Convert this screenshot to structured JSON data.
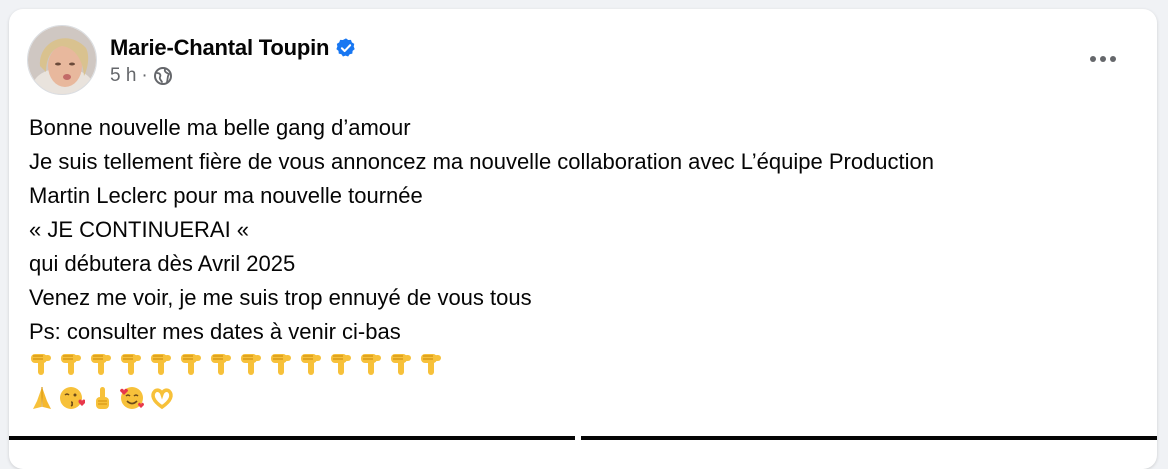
{
  "post": {
    "author_name": "Marie-Chantal Toupin",
    "timestamp": "5 h",
    "separator": "·",
    "audience_icon": "globe-icon",
    "verified_icon": "verified-badge-icon",
    "more_icon": "more-options-icon",
    "lines": [
      "Bonne nouvelle ma belle gang d’amour",
      "Je suis tellement fière de vous annoncez ma nouvelle collaboration avec L’équipe Production",
      "Martin Leclerc pour ma nouvelle tournée",
      "« JE CONTINUERAI «",
      "qui débutera dès Avril 2025",
      "Venez me voir, je me suis trop ennuyé de vous tous",
      "Ps: consulter mes dates à venir ci-bas"
    ],
    "emoji_row_1": [
      "backhand-index-pointing-down",
      "backhand-index-pointing-down",
      "backhand-index-pointing-down",
      "backhand-index-pointing-down",
      "backhand-index-pointing-down",
      "backhand-index-pointing-down",
      "backhand-index-pointing-down",
      "backhand-index-pointing-down",
      "backhand-index-pointing-down",
      "backhand-index-pointing-down",
      "backhand-index-pointing-down",
      "backhand-index-pointing-down",
      "backhand-index-pointing-down",
      "backhand-index-pointing-down"
    ],
    "emoji_row_2": [
      "folded-hands",
      "face-blowing-kiss",
      "index-pointing-up",
      "smiling-face-with-hearts",
      "heart-hands"
    ]
  },
  "colors": {
    "text_primary": "#050505",
    "text_secondary": "#65676b",
    "verified_blue": "#1877f2",
    "card_bg": "#ffffff",
    "page_bg": "#f0f2f5"
  }
}
